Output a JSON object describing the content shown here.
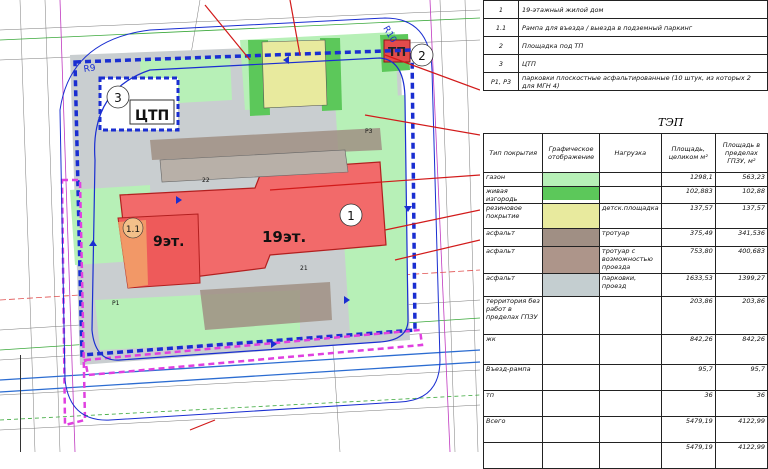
{
  "plan": {
    "building_19_floors": "19эт.",
    "building_9_floors": "9эт.",
    "building_19_num": "1",
    "building_9_num": "1.1",
    "tp_label": "ТП",
    "tp_num": "2",
    "ctp_label": "ЦТП",
    "ctp_num": "3",
    "label_r9": "R9",
    "label_r10": "R10",
    "label_p3": "P3",
    "label_p1": "P1",
    "label_22": "22",
    "label_21": "21"
  },
  "legend": {
    "rows": [
      {
        "key": "1",
        "text": "19-этажный жилой дом"
      },
      {
        "key": "1.1",
        "text": "Рампа для въезда / выезда в подземный паркинг"
      },
      {
        "key": "2",
        "text": "Площадка под ТП"
      },
      {
        "key": "3",
        "text": "ЦТП"
      },
      {
        "key": "Р1, Р3",
        "text": "парковки плоскостные асфальтированные (10 штук, из которых 2 для МГН 4)"
      }
    ]
  },
  "tep": {
    "title": "ТЭП",
    "headers": {
      "type": "Тип покрытия",
      "graphic": "Графическое отображение",
      "load": "Нагрузка",
      "area_total": "Площадь, целиком м²",
      "area_gpzu": "Площадь в пределах ГПЗУ, м²"
    },
    "rows": [
      {
        "type": "газон",
        "load": "",
        "area_total": "1298,1",
        "area_gpzu": "563,23",
        "color": "#b7f0b7"
      },
      {
        "type": "живая изгородь",
        "load": "",
        "area_total": "102,883",
        "area_gpzu": "102,88",
        "color": "#5cc85a"
      },
      {
        "type": "резиновое покрытие",
        "load": "детск.площадка",
        "area_total": "137,57",
        "area_gpzu": "137,57",
        "color": "#e8ea9e"
      },
      {
        "type": "асфальт",
        "load": "тротуар",
        "area_total": "375,49",
        "area_gpzu": "341,536",
        "color": "#a08f84"
      },
      {
        "type": "асфальт",
        "load": "тротуар с возможностью проезда",
        "area_total": "753,80",
        "area_gpzu": "400,683",
        "color": "#ad958a"
      },
      {
        "type": "асфальт",
        "load": "парковки, проезд",
        "area_total": "1633,53",
        "area_gpzu": "1399,27",
        "color": "#c4ced0"
      },
      {
        "type": "территория без работ в пределах ГПЗУ",
        "load": "",
        "area_total": "203,86",
        "area_gpzu": "203,86",
        "color": ""
      },
      {
        "type": "жк",
        "load": "",
        "area_total": "842,26",
        "area_gpzu": "842,26",
        "color": ""
      },
      {
        "type": "Въезд-рампа",
        "load": "",
        "area_total": "95,7",
        "area_gpzu": "95,7",
        "color": ""
      },
      {
        "type": "тп",
        "load": "",
        "area_total": "36",
        "area_gpzu": "36",
        "color": ""
      },
      {
        "type": "Всего",
        "load": "",
        "area_total": "5479,19",
        "area_gpzu": "4122,99",
        "color": ""
      },
      {
        "type": "",
        "load": "",
        "area_total": "5479,19",
        "area_gpzu": "4122,99",
        "color": ""
      }
    ]
  }
}
